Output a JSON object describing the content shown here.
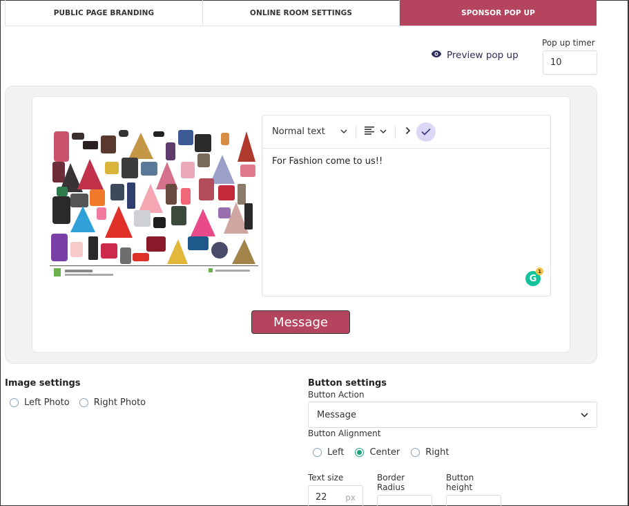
{
  "tabs": [
    {
      "label": "PUBLIC PAGE BRANDING"
    },
    {
      "label": "ONLINE ROOM SETTINGS"
    },
    {
      "label": "SPONSOR POP UP"
    }
  ],
  "active_tab": "SPONSOR POP UP",
  "preview": {
    "label": "Preview pop up",
    "icon": "eye-icon"
  },
  "timer": {
    "label": "Pop up timer",
    "value": "10"
  },
  "editor": {
    "format_select": "Normal text",
    "content": "For Fashion come to us!!",
    "grammarly_count": "1"
  },
  "popup_button": {
    "label": "Message"
  },
  "image_settings": {
    "title": "Image settings",
    "options": [
      "Left Photo",
      "Right Photo"
    ]
  },
  "button_settings": {
    "title": "Button settings",
    "action_label": "Button Action",
    "action_value": "Message",
    "alignment_label": "Button Alignment",
    "alignment_options": [
      "Left",
      "Center",
      "Right"
    ],
    "alignment_selected": "Center",
    "text_size_label": "Text size",
    "text_size_value": "22",
    "text_size_unit": "px",
    "border_radius_label": "Border\nRadius",
    "button_height_label": "Button\nheight"
  },
  "colors": {
    "accent": "#b5455f",
    "radio_on": "#1aa37a",
    "check_bg": "#dcd6f7"
  }
}
